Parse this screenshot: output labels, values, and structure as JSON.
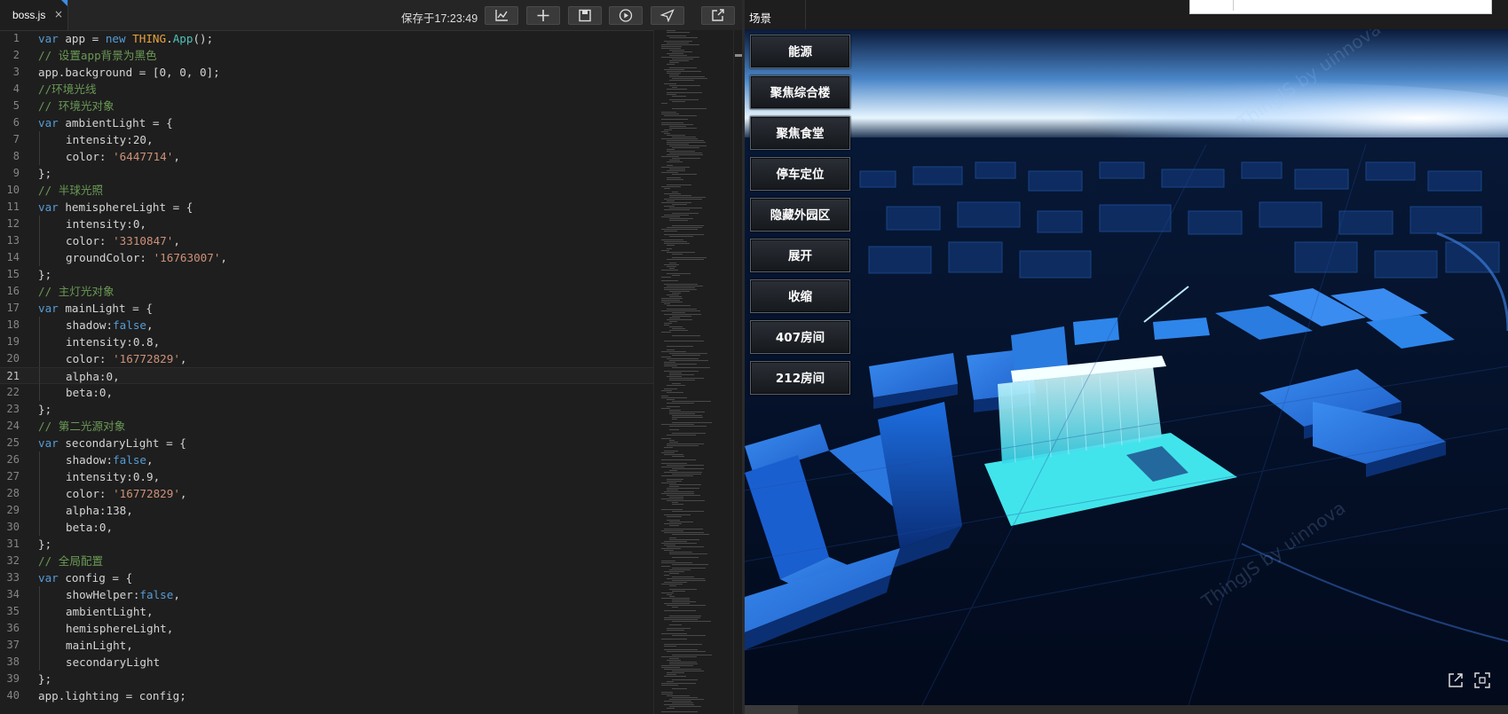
{
  "editor": {
    "file_tab": {
      "name": "boss.js",
      "close": "×"
    },
    "saved_status": "保存于17:23:49",
    "toolbar": [
      {
        "name": "stats-button",
        "icon": "chart-icon"
      },
      {
        "name": "add-button",
        "icon": "plus-icon"
      },
      {
        "name": "save-button",
        "icon": "save-icon"
      },
      {
        "name": "run-button",
        "icon": "play-icon"
      },
      {
        "name": "send-button",
        "icon": "send-icon"
      },
      {
        "name": "open-external-button",
        "icon": "external-link-icon"
      }
    ],
    "current_line": 21,
    "code_lines": [
      "var app = new THING.App();",
      "// 设置app背景为黑色",
      "app.background = [0, 0, 0];",
      "//环境光线",
      "// 环境光对象",
      "var ambientLight = {",
      "    intensity:20,",
      "    color: '6447714',",
      "};",
      "// 半球光照",
      "var hemisphereLight = {",
      "    intensity:0,",
      "    color: '3310847',",
      "    groundColor: '16763007',",
      "};",
      "// 主灯光对象",
      "var mainLight = {",
      "    shadow:false,",
      "    intensity:0.8,",
      "    color: '16772829',",
      "    alpha:0,",
      "    beta:0,",
      "};",
      "// 第二光源对象",
      "var secondaryLight = {",
      "    shadow:false,",
      "    intensity:0.9,",
      "    color: '16772829',",
      "    alpha:138,",
      "    beta:0,",
      "};",
      "// 全局配置",
      "var config = {",
      "    showHelper:false,",
      "    ambientLight,",
      "    hemisphereLight,",
      "    mainLight,",
      "    secondaryLight",
      "};",
      "app.lighting = config;"
    ]
  },
  "scene": {
    "tab_label": "场景",
    "buttons": [
      "能源",
      "聚焦综合楼",
      "聚焦食堂",
      "停车定位",
      "隐藏外园区",
      "展开",
      "收缩",
      "407房间",
      "212房间"
    ],
    "watermark": "ThingJS by uinnova",
    "corner_icons": [
      "open-external-icon",
      "fullscreen-icon"
    ],
    "colors": {
      "building": "#1f6bd6",
      "highlight": "#3fe6ee",
      "ground": "#04102a",
      "sky": "#dff4ff"
    }
  }
}
